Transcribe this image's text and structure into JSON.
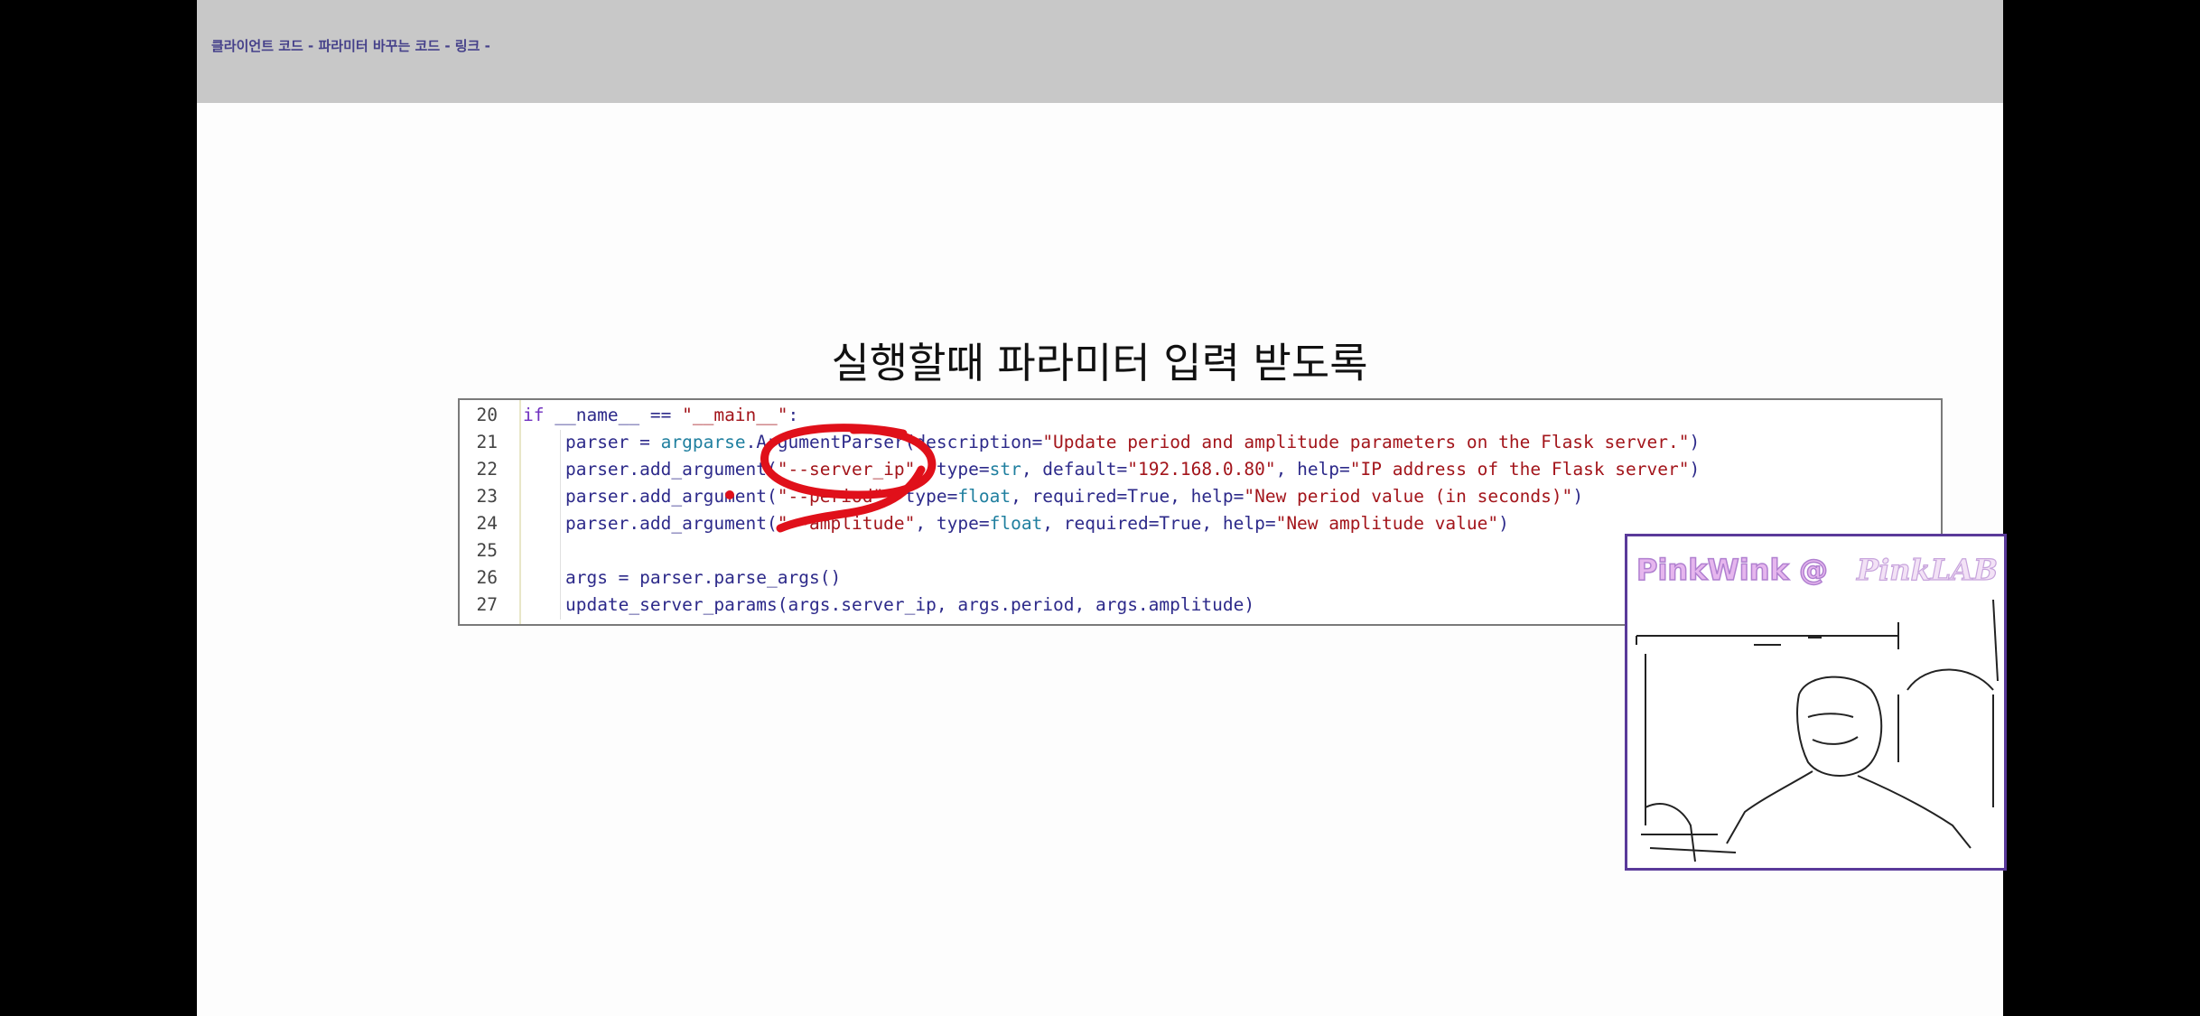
{
  "header": {
    "title": "클라이언트 코드 - 파라미터 바꾸는 코드 - 링크 -"
  },
  "slide": {
    "heading": "실행할때 파라미터 입력 받도록"
  },
  "code": {
    "lines": [
      {
        "num": "20",
        "indent": "",
        "parts": [
          [
            "kw",
            "if"
          ],
          [
            "p",
            " __name__ == "
          ],
          [
            "str",
            "\"__main__\""
          ],
          [
            "p",
            ":"
          ]
        ]
      },
      {
        "num": "21",
        "indent": "    ",
        "parts": [
          [
            "p",
            "parser = "
          ],
          [
            "mod",
            "argparse"
          ],
          [
            "p",
            "."
          ],
          [
            "fn",
            "ArgumentParser"
          ],
          [
            "p",
            "(description="
          ],
          [
            "str",
            "\"Update period and amplitude parameters on the Flask server.\""
          ],
          [
            "p",
            ")"
          ]
        ]
      },
      {
        "num": "22",
        "indent": "    ",
        "parts": [
          [
            "p",
            "parser.add_argument("
          ],
          [
            "str",
            "\"--server_ip\""
          ],
          [
            "p",
            ", type="
          ],
          [
            "ty",
            "str"
          ],
          [
            "p",
            ", default="
          ],
          [
            "str",
            "\"192.168.0.80\""
          ],
          [
            "p",
            ", help="
          ],
          [
            "str",
            "\"IP address of the Flask server\""
          ],
          [
            "p",
            ")"
          ]
        ]
      },
      {
        "num": "23",
        "indent": "    ",
        "parts": [
          [
            "p",
            "parser.add_argument("
          ],
          [
            "str",
            "\"--period\""
          ],
          [
            "p",
            ", type="
          ],
          [
            "ty",
            "float"
          ],
          [
            "p",
            ", required=True, help="
          ],
          [
            "str",
            "\"New period value (in seconds)\""
          ],
          [
            "p",
            ")"
          ]
        ]
      },
      {
        "num": "24",
        "indent": "    ",
        "parts": [
          [
            "p",
            "parser.add_argument("
          ],
          [
            "str",
            "\"--amplitude\""
          ],
          [
            "p",
            ", type="
          ],
          [
            "ty",
            "float"
          ],
          [
            "p",
            ", required=True, help="
          ],
          [
            "str",
            "\"New amplitude value\""
          ],
          [
            "p",
            ")"
          ]
        ]
      },
      {
        "num": "25",
        "indent": "",
        "parts": []
      },
      {
        "num": "26",
        "indent": "    ",
        "parts": [
          [
            "p",
            "args = parser.parse_args()"
          ]
        ]
      },
      {
        "num": "27",
        "indent": "    ",
        "parts": [
          [
            "p",
            "update_server_params(args.server_ip, args.period, args.amplitude)"
          ]
        ]
      }
    ]
  },
  "webcam": {
    "label_left": "PinkWink @",
    "label_right": "PinkLAB"
  },
  "colors": {
    "annotation": "#e0101a",
    "webcam_border": "#5a3a9a",
    "header_text": "#45408a"
  }
}
